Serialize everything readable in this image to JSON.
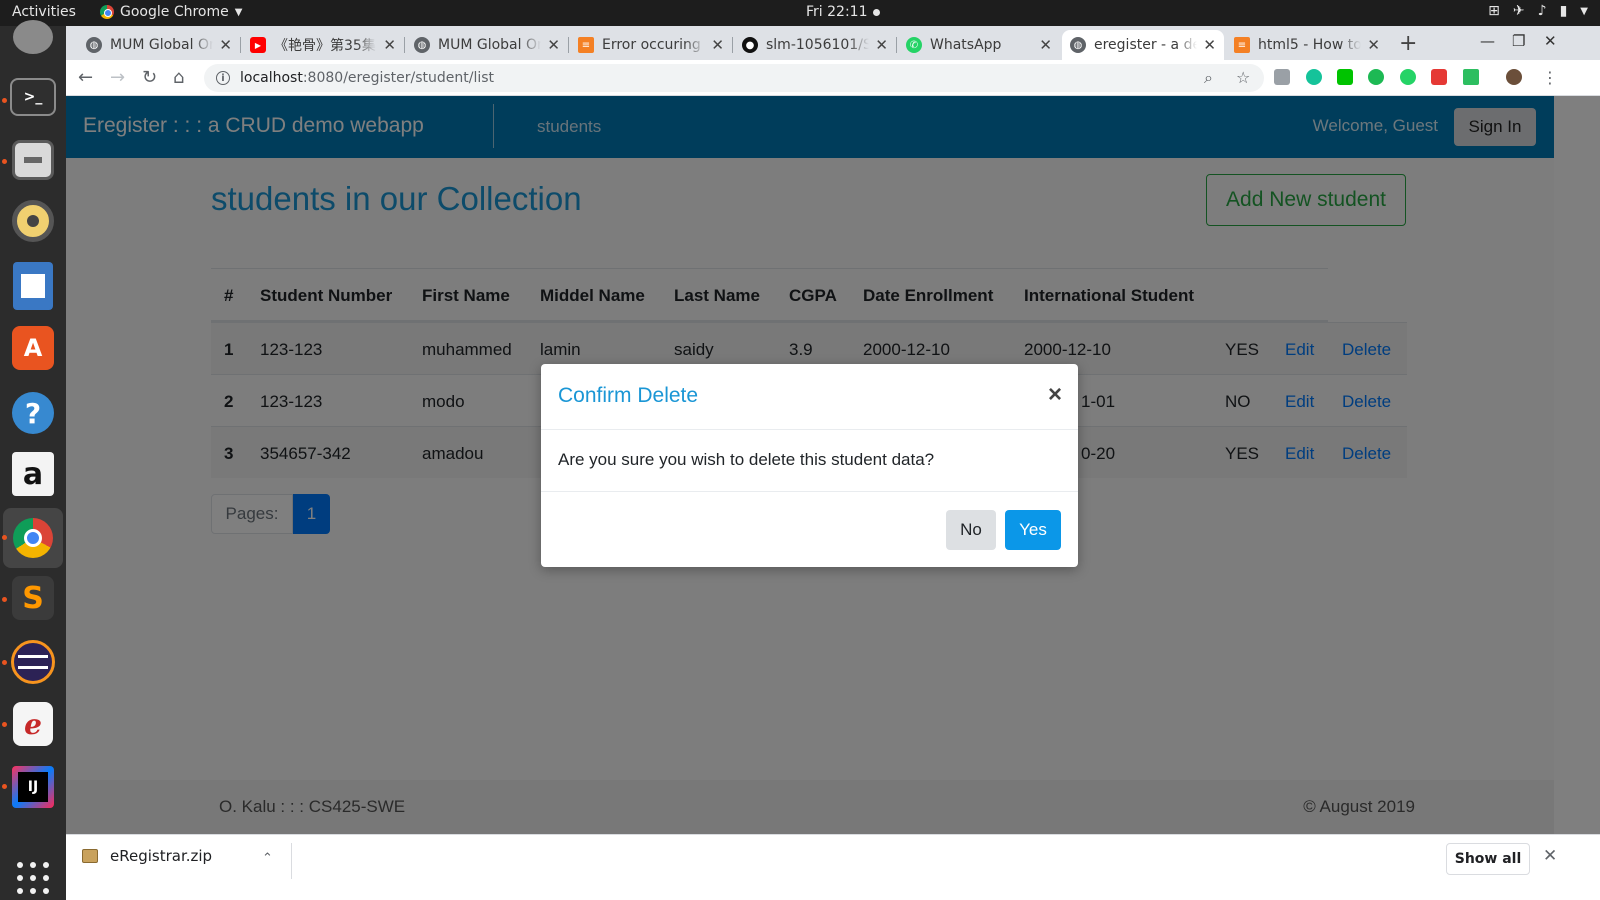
{
  "topbar": {
    "activities": "Activities",
    "app_name": "Google Chrome",
    "clock": "Fri 22:11"
  },
  "tabs": [
    {
      "title": "MUM Global Or",
      "icon": "globe-icon",
      "active": false
    },
    {
      "title": "《艳骨》第35集",
      "icon": "youtube-icon",
      "active": false
    },
    {
      "title": "MUM Global Or",
      "icon": "globe-icon",
      "active": false
    },
    {
      "title": "Error occuring",
      "icon": "stackoverflow-icon",
      "active": false
    },
    {
      "title": "slm-1056101/S",
      "icon": "github-icon",
      "active": false
    },
    {
      "title": "WhatsApp",
      "icon": "whatsapp-icon",
      "active": false
    },
    {
      "title": "eregister - a de",
      "icon": "globe-icon",
      "active": true
    },
    {
      "title": "html5 - How to",
      "icon": "stackoverflow-icon",
      "active": false
    }
  ],
  "address": {
    "host": "localhost",
    "path": ":8080/eregister/student/list"
  },
  "navbar": {
    "brand": "Eregister : : : a CRUD demo webapp",
    "link": "students",
    "welcome": "Welcome, Guest",
    "signin": "Sign In"
  },
  "main": {
    "title": "students in our Collection",
    "add_button": "Add New student",
    "pages_label": "Pages:",
    "current_page": "1"
  },
  "table": {
    "headers": [
      "#",
      "Student Number",
      "First Name",
      "Middel Name",
      "Last Name",
      "CGPA",
      "Date Enrollment",
      "International Student"
    ],
    "edit_label": "Edit",
    "delete_label": "Delete",
    "rows": [
      {
        "idx": "1",
        "number": "123-123",
        "first": "muhammed",
        "middle": "lamin",
        "last": "saidy",
        "cgpa": "3.9",
        "enrolled": "2000-12-10",
        "intl_date": "2000-12-10",
        "intl": "YES"
      },
      {
        "idx": "2",
        "number": "123-123",
        "first": "modo",
        "intl_date_partial": "1-01",
        "intl": "NO"
      },
      {
        "idx": "3",
        "number": "354657-342",
        "first": "amadou",
        "intl_date_partial": "0-20",
        "intl": "YES"
      }
    ]
  },
  "modal": {
    "title": "Confirm Delete",
    "message": "Are you sure you wish to delete this student data?",
    "no": "No",
    "yes": "Yes",
    "close": "×"
  },
  "footer": {
    "left": "O. Kalu : : : CS425-SWE",
    "right": "© August 2019"
  },
  "shelf": {
    "file": "eRegistrar.zip",
    "show_all": "Show all"
  },
  "colors": {
    "navbar": "#007bb6",
    "accent": "#1a96d5",
    "link": "#007bff",
    "success": "#28a745",
    "yes_button": "#0b97e8"
  }
}
